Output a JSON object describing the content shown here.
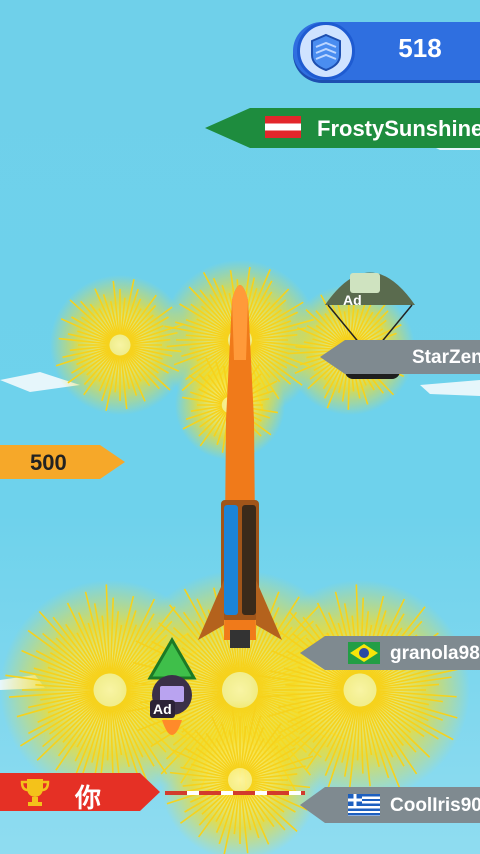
{
  "score": {
    "value": "518",
    "icon": "shield-stack-icon",
    "color": "#2f6fe0"
  },
  "players": {
    "frosty": {
      "name": "FrostySunshine",
      "flag": "austria-flag"
    },
    "starzen": {
      "name": "StarZen"
    },
    "granola": {
      "name": "granola98",
      "flag": "brazil-flag"
    },
    "cooliris": {
      "name": "CoolIris90",
      "flag": "greece-flag"
    }
  },
  "altitude_marker": {
    "value": "500"
  },
  "you_marker": {
    "label": "你",
    "icon": "trophy-icon"
  },
  "ad_drops": {
    "parachute_label": "Ad",
    "rocket_label": "Ad"
  }
}
